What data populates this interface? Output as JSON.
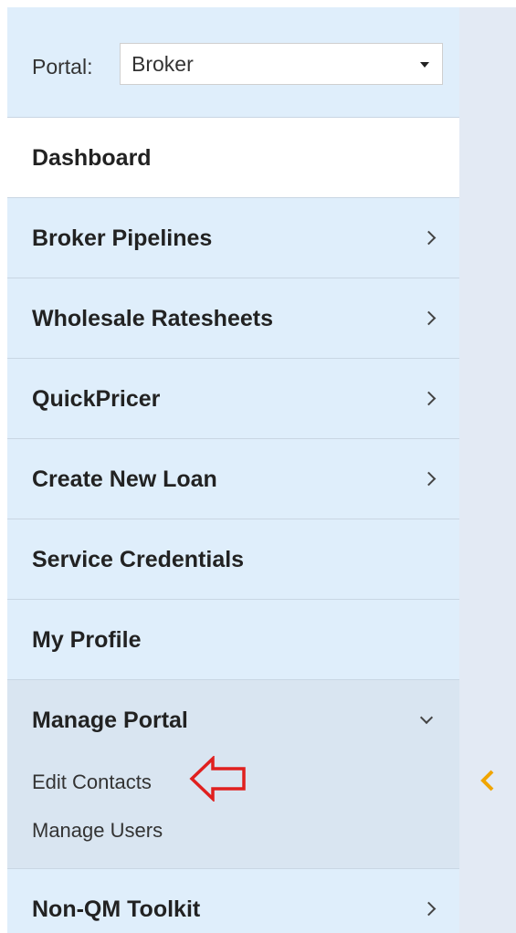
{
  "portal": {
    "label": "Portal:",
    "selected": "Broker"
  },
  "nav": {
    "items": [
      {
        "label": "Dashboard",
        "chevron": "none",
        "active": true
      },
      {
        "label": "Broker Pipelines",
        "chevron": "right"
      },
      {
        "label": "Wholesale Ratesheets",
        "chevron": "right"
      },
      {
        "label": "QuickPricer",
        "chevron": "right"
      },
      {
        "label": "Create New Loan",
        "chevron": "right"
      },
      {
        "label": "Service Credentials",
        "chevron": "none"
      },
      {
        "label": "My Profile",
        "chevron": "none"
      }
    ],
    "manage_portal": {
      "label": "Manage Portal",
      "expanded": true,
      "sub_items": [
        {
          "label": "Edit Contacts"
        },
        {
          "label": "Manage Users"
        }
      ]
    },
    "last_item": {
      "label": "Non-QM Toolkit",
      "chevron": "right"
    }
  },
  "icons": {
    "pointer_arrow": "left-arrow-annotation-icon",
    "collapse": "chevron-left-icon"
  },
  "colors": {
    "sidebar_bg": "#dfeefb",
    "active_bg": "#ffffff",
    "expanded_bg": "#d9e5f1",
    "annotation_arrow": "#e0201f",
    "collapse_chevron": "#f0a500"
  }
}
